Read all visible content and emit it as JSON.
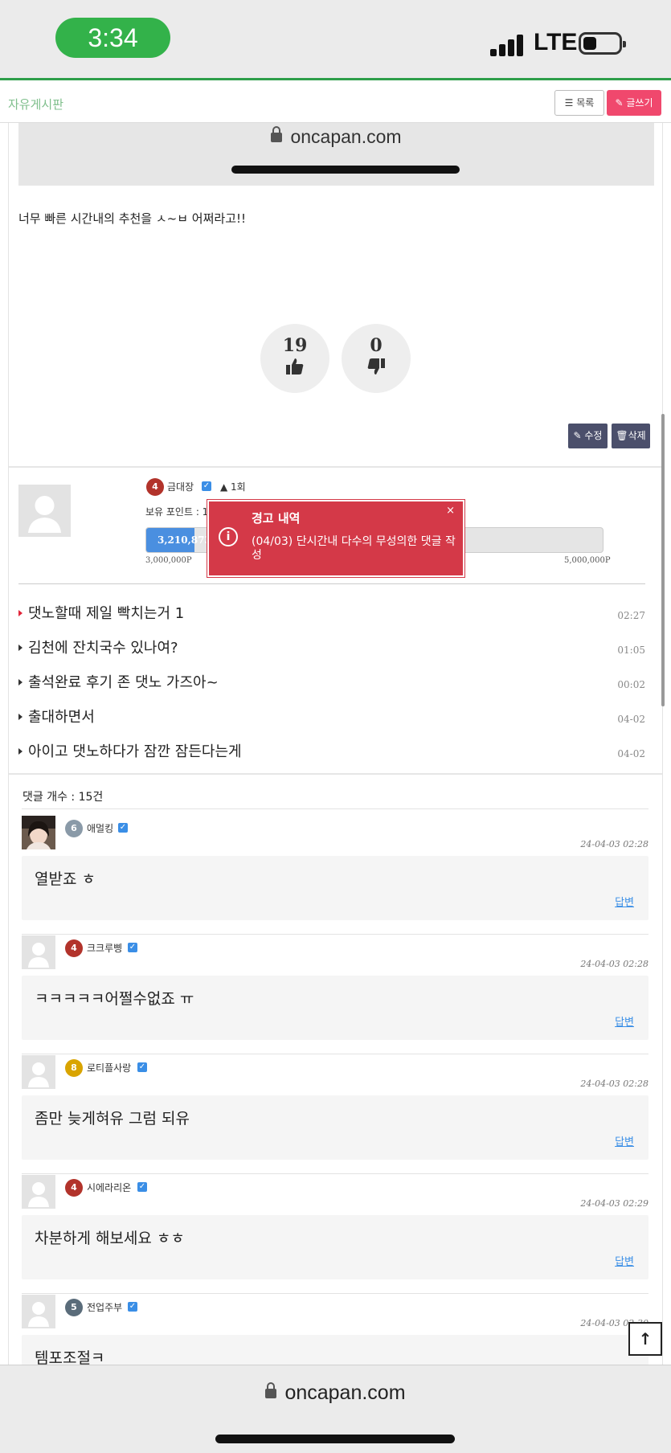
{
  "status_bar": {
    "time": "3:34",
    "network": "LTE"
  },
  "header": {
    "board_title": "자유게시판",
    "list_button": "목록",
    "write_button": "글쓰기"
  },
  "post": {
    "embedded_url": "oncapan.com",
    "text": "너무 빠른 시간내의 추천을 ㅅ~ㅂ 어쩌라고!!",
    "likes": "19",
    "dislikes": "0",
    "edit_button": "수정",
    "delete_button": "삭제"
  },
  "author": {
    "level": "4",
    "name": "금대장",
    "warnings": "1회",
    "points_label": "보유 포인트 : 1",
    "points_value": "3,210,873",
    "points_min": "3,000,000P",
    "points_max": "5,000,000P",
    "points_progress": 0.105
  },
  "warning_toast": {
    "title": "경고 내역",
    "message": "(04/03) 단시간내 다수의 무성의한 댓글 작성",
    "close": "×"
  },
  "related_posts": [
    {
      "title": "댓노할때 제일 빡치는거 1",
      "time": "02:27",
      "new": true
    },
    {
      "title": "김천에 잔치국수 있나여?",
      "time": "01:05",
      "new": false
    },
    {
      "title": "출석완료 후기 존 댓노 가즈아~",
      "time": "00:02",
      "new": false
    },
    {
      "title": "출대하면서",
      "time": "04-02",
      "new": false
    },
    {
      "title": "아이고 댓노하다가 잠깐 잠든다는게",
      "time": "04-02",
      "new": false
    }
  ],
  "comments_count_label": "댓글 개수 : 15건",
  "reply_label": "답변",
  "comments": [
    {
      "name": "애멀킹",
      "level": "6",
      "date": "24-04-03 02:28",
      "text": "열받죠 ㅎ",
      "photo": true
    },
    {
      "name": "크크루삥",
      "level": "4",
      "date": "24-04-03 02:28",
      "text": "ㅋㅋㅋㅋㅋ어쩔수없죠 ㅠ",
      "photo": false
    },
    {
      "name": "로티플사랑",
      "level": "8",
      "date": "24-04-03 02:28",
      "text": "좀만 늦게혀유 그럼 되유",
      "photo": false
    },
    {
      "name": "시에라리온",
      "level": "4",
      "date": "24-04-03 02:29",
      "text": "차분하게 해보세요 ㅎㅎ",
      "photo": false
    },
    {
      "name": "전업주부",
      "level": "5",
      "date": "24-04-03 02:30",
      "text": "템포조절ㅋ",
      "photo": false
    }
  ],
  "bottom_bar": {
    "url": "oncapan.com"
  },
  "colors": {
    "accent_green": "#33b24a",
    "write_pink": "#f0486d",
    "toast_red": "#d43948",
    "progress_blue": "#4a8fe0"
  }
}
